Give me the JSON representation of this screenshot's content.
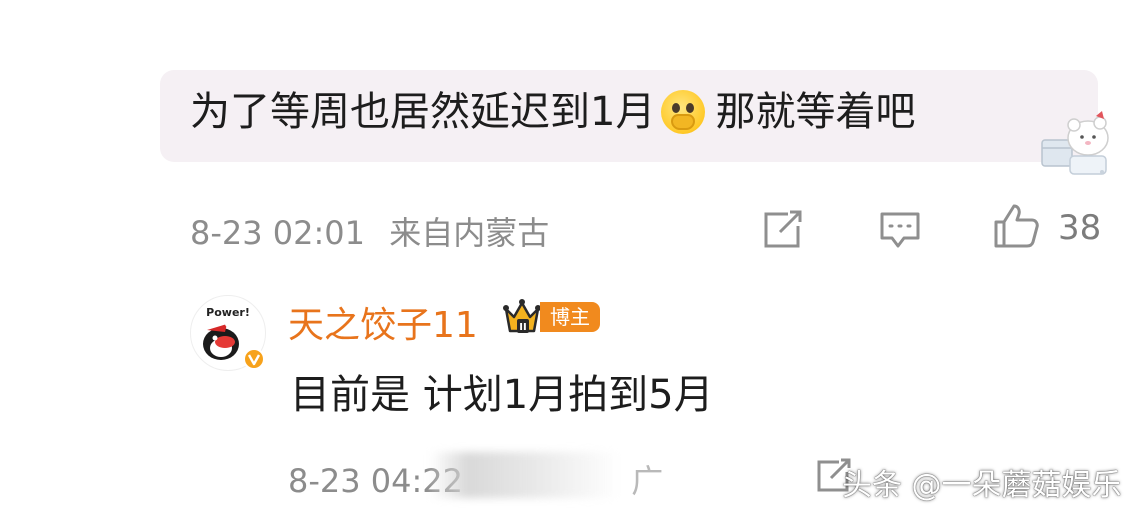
{
  "comment": {
    "text_before_emoji": "为了等周也居然延迟到1月",
    "emoji_icon": "pleading-hands-emoji",
    "text_after_emoji": "那就等着吧",
    "time": "8-23 02:01",
    "location": "来自内蒙古",
    "likes": "38"
  },
  "reply": {
    "avatar_text": "Power!",
    "username": "天之饺子11",
    "badge": "博主",
    "text": "目前是 计划1月拍到5月",
    "time": "8-23 04:22",
    "location_suffix": "广"
  },
  "watermark": "头条 @一朵蘑菇娱乐",
  "colors": {
    "bubble_bg": "#f5f0f4",
    "username": "#e8741c",
    "badge_bg": "#f18a1e",
    "meta_text": "#8c8c8c"
  }
}
